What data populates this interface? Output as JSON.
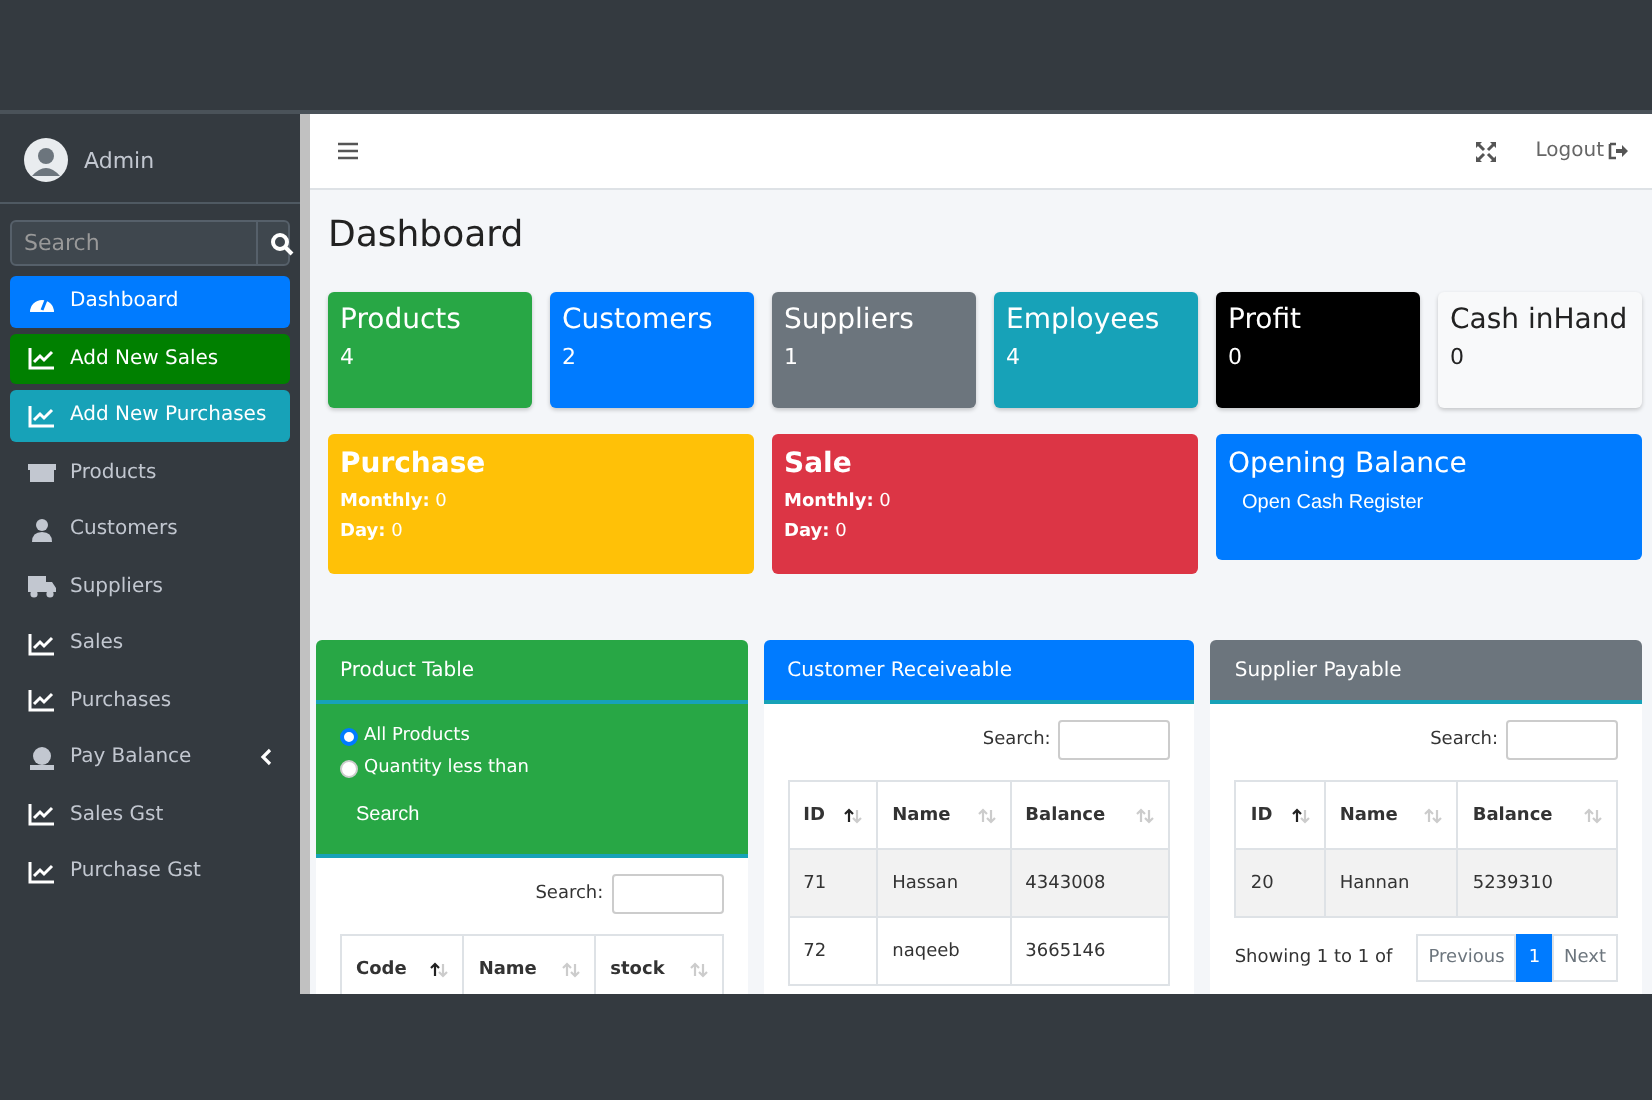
{
  "sidebar": {
    "user": {
      "name": "Admin"
    },
    "search": {
      "placeholder": "Search"
    },
    "items": [
      {
        "label": "Dashboard",
        "kind": "gauge",
        "color": "#007bff",
        "submenu": false
      },
      {
        "label": "Add New Sales",
        "kind": "chart",
        "color": "#008000",
        "submenu": false
      },
      {
        "label": "Add New Purchases",
        "kind": "chart",
        "color": "#17a2b8",
        "submenu": false
      },
      {
        "label": "Products",
        "kind": "box",
        "submenu": false
      },
      {
        "label": "Customers",
        "kind": "user",
        "submenu": false
      },
      {
        "label": "Suppliers",
        "kind": "truck",
        "submenu": false
      },
      {
        "label": "Sales",
        "kind": "chart",
        "submenu": false
      },
      {
        "label": "Purchases",
        "kind": "chart",
        "submenu": false
      },
      {
        "label": "Pay Balance",
        "kind": "money",
        "submenu": true
      },
      {
        "label": "Sales Gst",
        "kind": "chart",
        "submenu": false
      },
      {
        "label": "Purchase Gst",
        "kind": "chart",
        "submenu": false
      }
    ]
  },
  "navbar": {
    "logout": "Logout"
  },
  "page_title": "Dashboard",
  "stat_cards": [
    {
      "title": "Products",
      "value": "4",
      "color": "#28a745",
      "kind": "solid"
    },
    {
      "title": "Customers",
      "value": "2",
      "color": "#007bff",
      "kind": "solid"
    },
    {
      "title": "Suppliers",
      "value": "1",
      "color": "#6c757d",
      "kind": "solid"
    },
    {
      "title": "Employees",
      "value": "4",
      "color": "#17a2b8",
      "kind": "solid"
    },
    {
      "title": "Profit",
      "value": "0",
      "color": "#000000",
      "kind": "solid"
    },
    {
      "title": "Cash inHand",
      "value": "0",
      "color": "#f8f9fa",
      "kind": "light"
    }
  ],
  "summary_cards": [
    {
      "title": "Purchase",
      "color": "#ffc107",
      "kind": "stats",
      "lines": [
        {
          "label": "Monthly:",
          "value": "0"
        },
        {
          "label": "Day:",
          "value": "0"
        }
      ]
    },
    {
      "title": "Sale",
      "color": "#dc3545",
      "kind": "stats",
      "lines": [
        {
          "label": "Monthly:",
          "value": "0"
        },
        {
          "label": "Day:",
          "value": "0"
        }
      ]
    },
    {
      "title": "Opening Balance",
      "color": "#007bff",
      "kind": "action",
      "button": "Open Cash Register"
    }
  ],
  "panels": [
    {
      "title": "Product Table",
      "color": "#28a745",
      "kind": "filter",
      "radios": [
        {
          "label": "All Products",
          "selected": true
        },
        {
          "label": "Quantity less than",
          "selected": false
        }
      ],
      "button": "Search",
      "search_label": "Search:",
      "columns": [
        {
          "label": "Code",
          "sorted": true
        },
        {
          "label": "Name",
          "sorted": false
        },
        {
          "label": "stock",
          "sorted": false
        }
      ]
    },
    {
      "title": "Customer Receiveable",
      "color": "#007bff",
      "kind": "table",
      "search_label": "Search:",
      "columns": [
        {
          "label": "ID",
          "sorted": true
        },
        {
          "label": "Name",
          "sorted": false
        },
        {
          "label": "Balance",
          "sorted": false
        }
      ],
      "rows": [
        [
          "71",
          "Hassan",
          "4343008"
        ],
        [
          "72",
          "naqeeb",
          "3665146"
        ]
      ]
    },
    {
      "title": "Supplier Payable",
      "color": "#6c757d",
      "kind": "table",
      "search_label": "Search:",
      "columns": [
        {
          "label": "ID",
          "sorted": true
        },
        {
          "label": "Name",
          "sorted": false
        },
        {
          "label": "Balance",
          "sorted": false
        }
      ],
      "rows": [
        [
          "20",
          "Hannan",
          "5239310"
        ]
      ],
      "info": "Showing 1 to 1 of",
      "pagination": [
        {
          "label": "Previous",
          "selected": false
        },
        {
          "label": "1",
          "selected": true
        },
        {
          "label": "Next",
          "selected": false
        }
      ]
    }
  ]
}
